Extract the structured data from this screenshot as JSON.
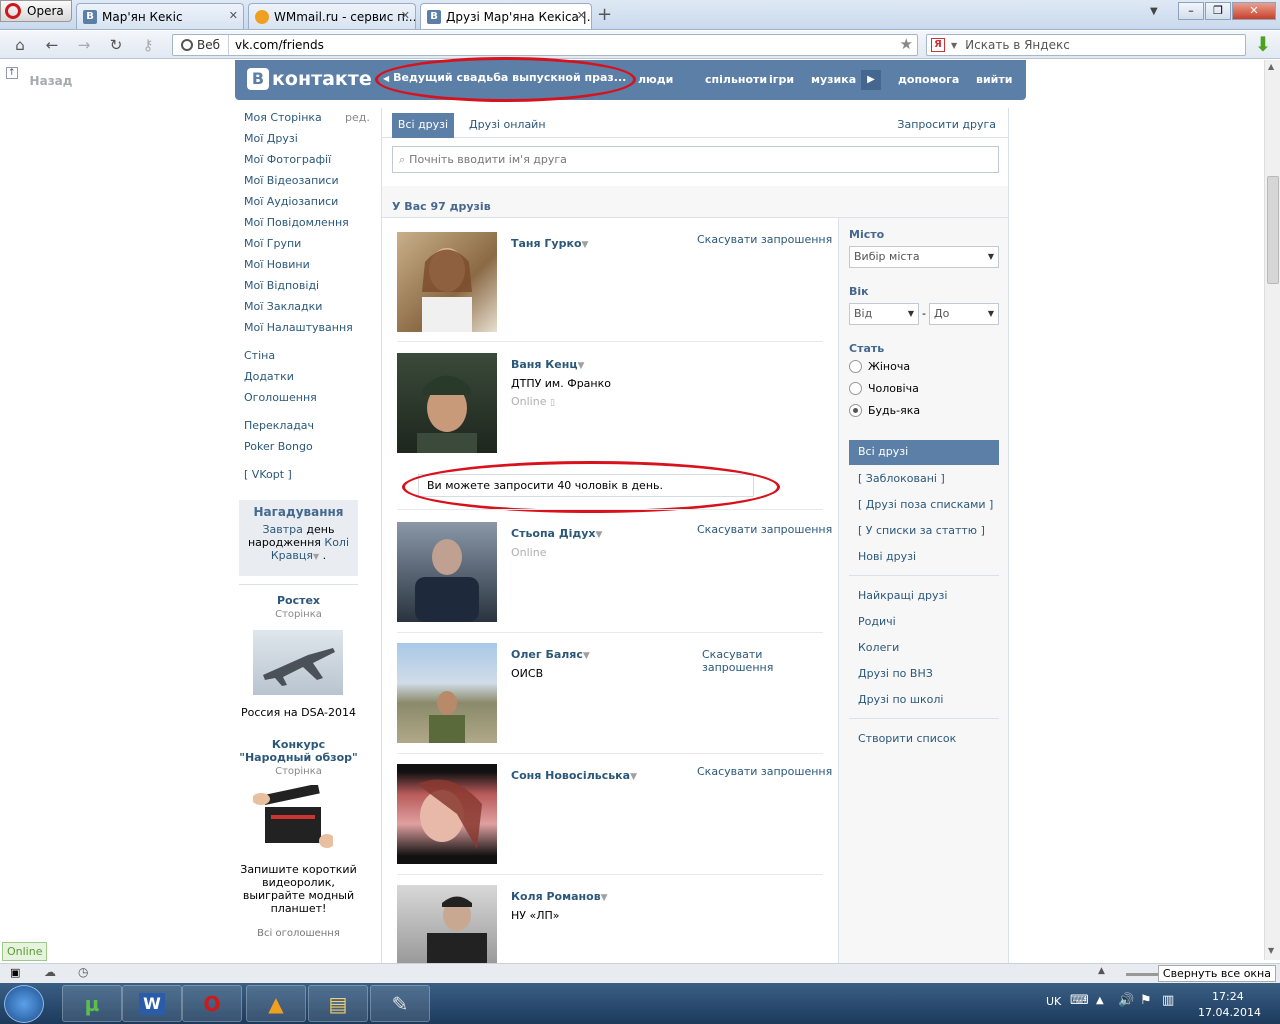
{
  "browser": {
    "opera_label": "Opera",
    "tabs": [
      {
        "icon": "vk-favicon",
        "title": "Мар'ян Кекіс"
      },
      {
        "icon": "wmmail-favicon",
        "title": "WMmail.ru - сервис п..."
      },
      {
        "icon": "vk-favicon",
        "title": "Друзі Мар'яна Кекіса |..."
      }
    ],
    "web_label": "Веб",
    "url": "vk.com/friends",
    "search_placeholder": "Искать в Яндекс",
    "yandex_letter": "Я"
  },
  "back_label": "Назад",
  "header": {
    "logo_letter": "В",
    "logo_text": "контакте",
    "status": "Ведущий свадьба выпускной праз...",
    "nav": [
      "люди",
      "спільноти",
      "ігри",
      "музика",
      "допомога",
      "вийти"
    ]
  },
  "left_menu": {
    "edit": "ред.",
    "group1": [
      "Моя Сторінка",
      "Мої Друзі",
      "Мої Фотографії",
      "Мої Відеозаписи",
      "Мої Аудіозаписи",
      "Мої Повідомлення",
      "Мої Групи",
      "Мої Новини",
      "Мої Відповіді",
      "Мої Закладки",
      "Мої Налаштування"
    ],
    "group2": [
      "Стіна",
      "Додатки",
      "Оголошення"
    ],
    "group3": [
      "Перекладач",
      "Poker Bongo"
    ],
    "vkopt": "[ VKopt ]"
  },
  "reminder": {
    "title": "Нагадування",
    "tomorrow": "Завтра",
    "text1": "день",
    "text2": "народження",
    "name1": "Колі",
    "name2": "Кравця",
    "dot": "."
  },
  "ads": [
    {
      "title": "Ростех",
      "sub": "Сторінка",
      "caption": "Россия на DSA-2014"
    },
    {
      "title1": "Конкурс",
      "title2": "\"Народный обзор\"",
      "sub": "Сторінка",
      "caption": "Запишите короткий видеоролик, выиграйте модный планшет!"
    }
  ],
  "ads_all": "Всі оголошення",
  "tabs": {
    "all": "Всі друзі",
    "online": "Друзі онлайн",
    "invite": "Запросити друга"
  },
  "search_placeholder": "Почніть вводити ім'я друга",
  "friends_count": "У Вас 97 друзів",
  "limit_message": "Ви можете запросити 40 чоловік в день.",
  "friends": [
    {
      "name": "Таня Гурко",
      "info": "",
      "online": "",
      "action": "Скасувати запрошення"
    },
    {
      "name": "Ваня Кенц",
      "info": "ДТПУ им. Франко",
      "online": "Online",
      "action": ""
    },
    {
      "name": "Стьопа Дідух",
      "info": "",
      "online": "Online",
      "action": "Скасувати запрошення"
    },
    {
      "name": "Олег Баляс",
      "info": "ОИСВ",
      "online": "",
      "action": "Скасувати запрошення"
    },
    {
      "name": "Соня Новосільська",
      "info": "",
      "online": "",
      "action": "Скасувати запрошення"
    },
    {
      "name": "Коля Романов",
      "info": "НУ «ЛП»",
      "online": "",
      "action": ""
    }
  ],
  "filter": {
    "city_label": "Місто",
    "city_select": "Вибір міста",
    "age_label": "Вік",
    "age_from": "Від",
    "age_dash": "-",
    "age_to": "До",
    "sex_label": "Стать",
    "sex_options": [
      "Жіноча",
      "Чоловіча",
      "Будь-яка"
    ],
    "sex_selected": "Будь-яка",
    "lists1": [
      "Всі друзі",
      "[ Заблоковані ]",
      "[ Друзі поза списками ]",
      "[ У списки за статтю ]",
      "Нові друзі"
    ],
    "lists2": [
      "Найкращі друзі",
      "Родичі",
      "Колеги",
      "Друзі по ВНЗ",
      "Друзі по школі"
    ],
    "create_list": "Створити список"
  },
  "statusbar": {
    "online_badge": "Online",
    "collapse": "Свернуть все окна"
  },
  "tray": {
    "lang": "UK",
    "time": "17:24",
    "date": "17.04.2014"
  },
  "colors": {
    "vk_blue": "#5b7fa6",
    "link": "#2b587a",
    "annotation_red": "#d8121c"
  }
}
